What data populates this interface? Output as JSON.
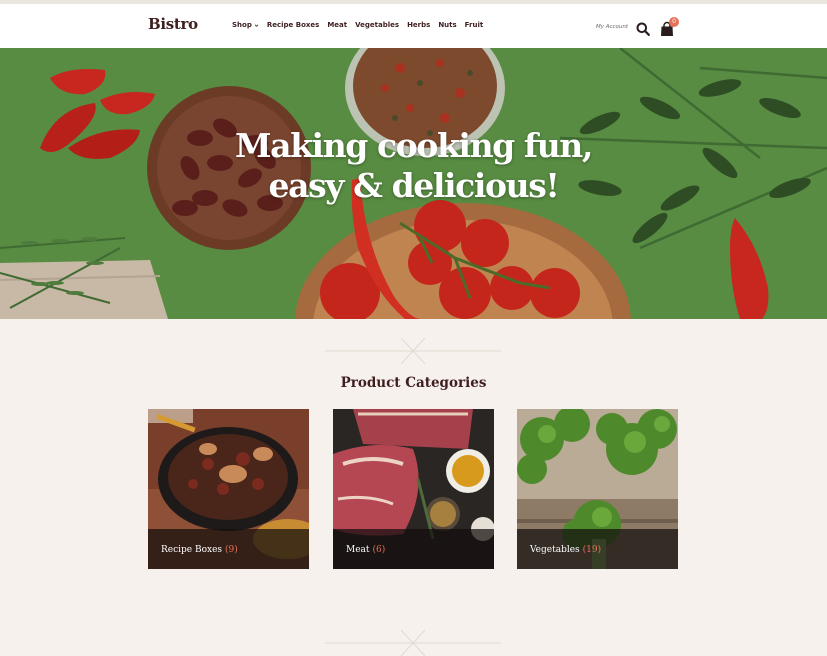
{
  "header": {
    "logo": "Bistro",
    "nav": [
      {
        "label": "Shop",
        "has_dropdown": true
      },
      {
        "label": "Recipe Boxes"
      },
      {
        "label": "Meat"
      },
      {
        "label": "Vegetables"
      },
      {
        "label": "Herbs"
      },
      {
        "label": "Nuts"
      },
      {
        "label": "Fruit"
      }
    ],
    "account_label": "My Account",
    "cart_count": "0",
    "icons": [
      "search-icon",
      "bag-icon",
      "chevron-down-icon"
    ]
  },
  "hero": {
    "line1": "Making cooking fun,",
    "line2": "easy & delicious!"
  },
  "categories": {
    "title": "Product Categories",
    "items": [
      {
        "name": "Recipe Boxes",
        "count": "(9)"
      },
      {
        "name": "Meat",
        "count": "(6)"
      },
      {
        "name": "Vegetables",
        "count": "(19)"
      }
    ]
  },
  "colors": {
    "brand_dark": "#3e1e1e",
    "accent": "#e8715a",
    "page_bg": "#f6f1ec",
    "hero_green": "#5a8f44"
  }
}
